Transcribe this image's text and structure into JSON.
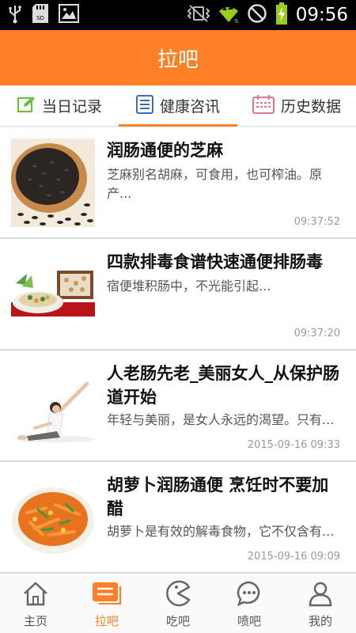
{
  "status_bar": {
    "time": "09:56",
    "icons": [
      "usb-icon",
      "sd-card-icon",
      "image-icon",
      "vibrate-icon",
      "wifi-icon",
      "no-sim-icon",
      "battery-charging-icon"
    ]
  },
  "header": {
    "title": "拉吧"
  },
  "tabs": [
    {
      "label": "当日记录",
      "icon": "edit-icon"
    },
    {
      "label": "健康咨讯",
      "icon": "news-icon"
    },
    {
      "label": "历史数据",
      "icon": "calendar-icon"
    }
  ],
  "active_tab": "健康咨讯",
  "articles": [
    {
      "title": "润肠通便的芝麻",
      "summary": "芝麻别名胡麻，可食用，也可榨油。原产...",
      "time": "09:37:52",
      "image": "sesame-seeds-image"
    },
    {
      "title": "四款排毒食谱快速通便排肠毒",
      "summary": "宿便堆积肠中，不光能引起...",
      "time": "09:37:20",
      "image": "dishes-image"
    },
    {
      "title": "人老肠先老_美丽女人_从保护肠道开始",
      "summary": "年轻与美丽，是女人永远的渴望。只有...",
      "time": "2015-09-16 09:33",
      "image": "yoga-woman-image"
    },
    {
      "title": "胡萝卜润肠通便 烹饪时不要加醋",
      "summary": "胡萝卜是有效的解毒食物，它不仅含有...",
      "time": "2015-09-16 09:09",
      "image": "carrot-dish-image"
    }
  ],
  "bottom_nav": [
    {
      "label": "主页",
      "icon": "home-icon"
    },
    {
      "label": "拉吧",
      "icon": "chat-box-icon"
    },
    {
      "label": "吃吧",
      "icon": "pacman-icon"
    },
    {
      "label": "喷吧",
      "icon": "speech-bubble-icon"
    },
    {
      "label": "我的",
      "icon": "person-icon"
    }
  ],
  "active_nav": "拉吧",
  "colors": {
    "accent": "#ff7f27",
    "status_bar": "#000000",
    "wifi": "#9ccc1a",
    "battery": "#9ccc1a"
  }
}
